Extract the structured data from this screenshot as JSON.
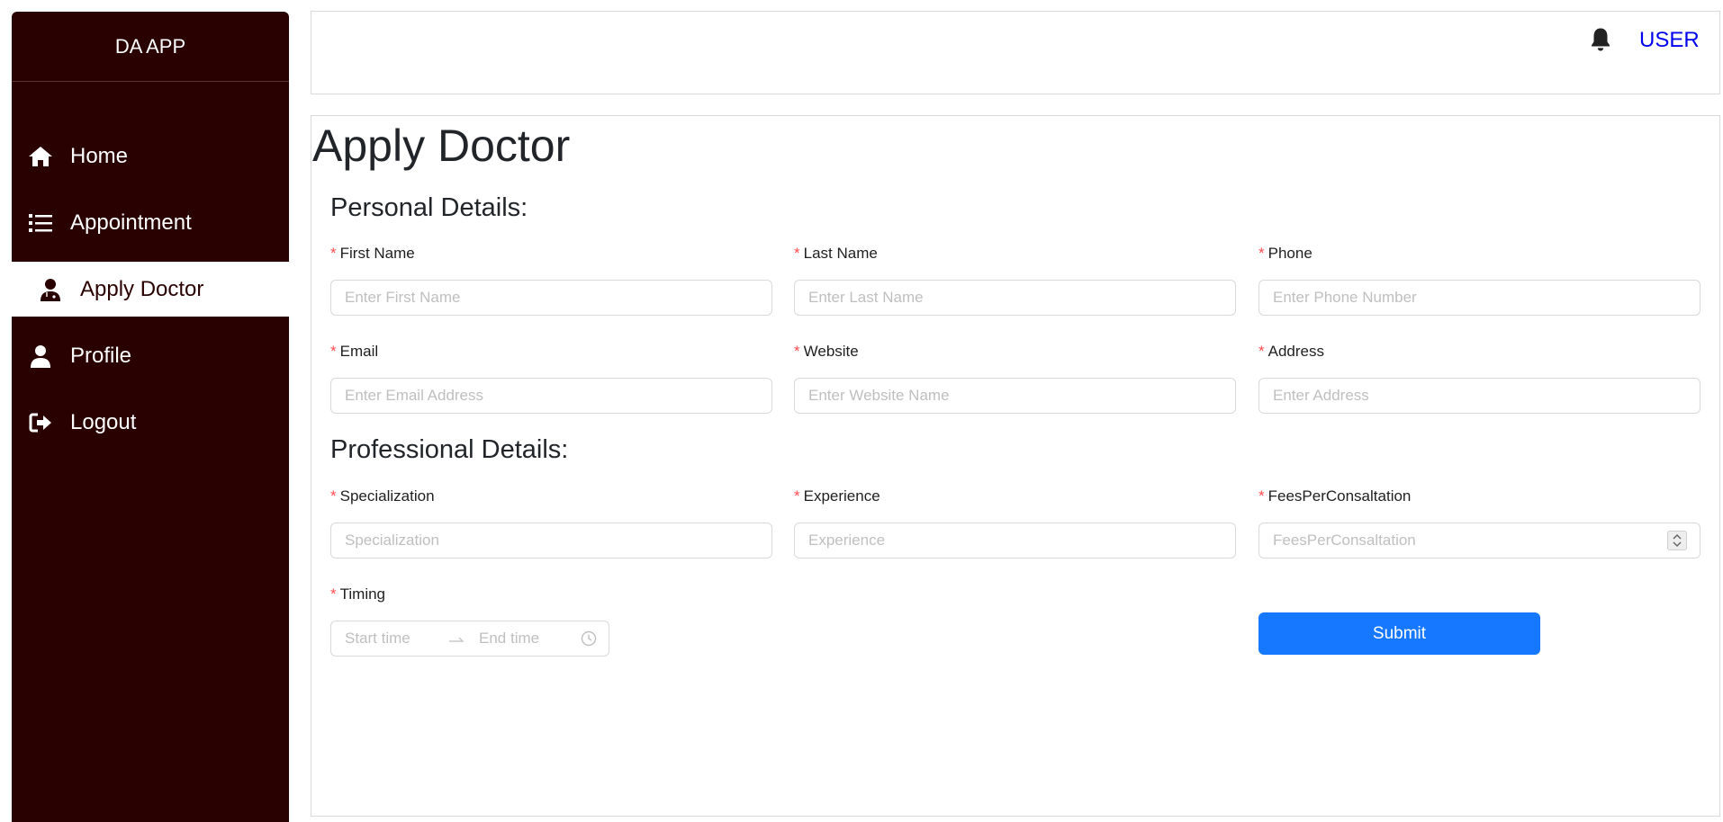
{
  "app": {
    "brand": "DA APP"
  },
  "sidebar": {
    "items": [
      {
        "label": "Home",
        "icon": "home-icon"
      },
      {
        "label": "Appointment",
        "icon": "list-icon"
      },
      {
        "label": "Apply Doctor",
        "icon": "user-doctor-icon",
        "active": true
      },
      {
        "label": "Profile",
        "icon": "user-icon"
      },
      {
        "label": "Logout",
        "icon": "logout-icon"
      }
    ]
  },
  "header": {
    "user_label": "USER",
    "bell_icon": "bell-icon"
  },
  "main": {
    "title": "Apply Doctor",
    "personal_title": "Personal Details:",
    "professional_title": "Professional Details:",
    "fields": {
      "first_name": {
        "label": "First Name",
        "placeholder": "Enter First Name"
      },
      "last_name": {
        "label": "Last Name",
        "placeholder": "Enter Last Name"
      },
      "phone": {
        "label": "Phone",
        "placeholder": "Enter Phone Number"
      },
      "email": {
        "label": "Email",
        "placeholder": "Enter Email Address"
      },
      "website": {
        "label": "Website",
        "placeholder": "Enter Website Name"
      },
      "address": {
        "label": "Address",
        "placeholder": "Enter Address"
      },
      "specialization": {
        "label": "Specialization",
        "placeholder": "Specialization"
      },
      "experience": {
        "label": "Experience",
        "placeholder": "Experience"
      },
      "fees": {
        "label": "FeesPerConsaltation",
        "placeholder": "FeesPerConsaltation"
      },
      "timing": {
        "label": "Timing",
        "start_placeholder": "Start time",
        "end_placeholder": "End time"
      }
    },
    "required_mark": "*",
    "submit_label": "Submit"
  },
  "colors": {
    "sidebar_bg": "#2a0101",
    "primary": "#1677ff",
    "required": "#ff4d4f",
    "link": "#0000ee"
  }
}
